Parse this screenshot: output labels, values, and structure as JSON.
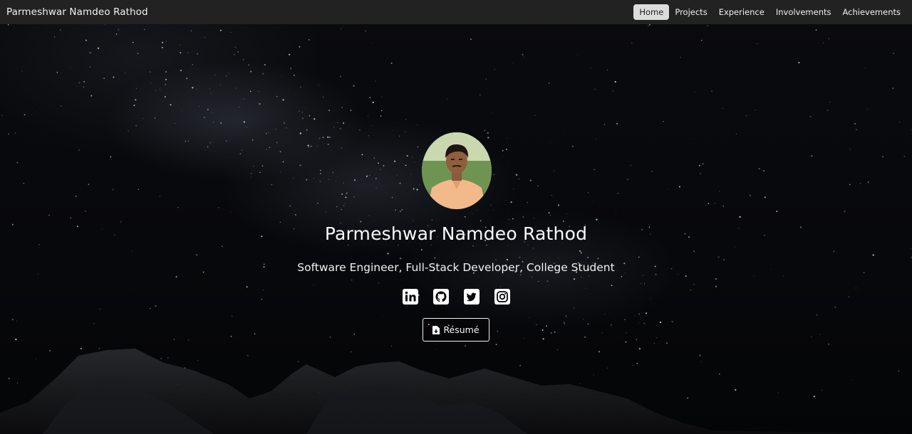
{
  "navbar": {
    "brand": "Parmeshwar Namdeo Rathod",
    "links": [
      {
        "label": "Home",
        "active": true
      },
      {
        "label": "Projects",
        "active": false
      },
      {
        "label": "Experience",
        "active": false
      },
      {
        "label": "Involvements",
        "active": false
      },
      {
        "label": "Achievements",
        "active": false
      }
    ]
  },
  "profile": {
    "name": "Parmeshwar Namdeo Rathod",
    "subtitle": "Software Engineer, Full-Stack Developer, College Student",
    "socials": [
      "linkedin-icon",
      "github-icon",
      "twitter-icon",
      "instagram-icon"
    ],
    "resume_label": "Résumé"
  },
  "colors": {
    "navbar_bg": "#222222",
    "active_link_bg": "#dcdcdc",
    "text": "#ffffff"
  }
}
